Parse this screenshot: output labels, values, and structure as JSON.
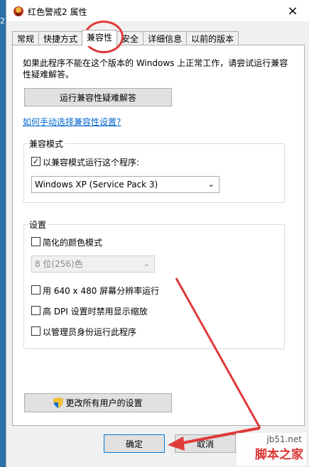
{
  "desktop": {
    "edge_number": "2"
  },
  "window": {
    "title": "红色警戒2 属性",
    "close_icon": "×"
  },
  "tabs": [
    {
      "label": "常规"
    },
    {
      "label": "快捷方式"
    },
    {
      "label": "兼容性"
    },
    {
      "label": "安全"
    },
    {
      "label": "详细信息"
    },
    {
      "label": "以前的版本"
    }
  ],
  "active_tab": "兼容性",
  "intro_text": "如果此程序不能在这个版本的 Windows 上正常工作，请尝试运行兼容性疑难解答。",
  "troubleshooter_button": "运行兼容性疑难解答",
  "manual_link": "如何手动选择兼容性设置?",
  "compat_mode": {
    "group_label": "兼容模式",
    "checkbox_label": "以兼容模式运行这个程序:",
    "checked": true,
    "selected_os": "Windows XP (Service Pack 3)"
  },
  "settings": {
    "group_label": "设置",
    "reduced_color_label": "简化的颜色模式",
    "color_select_value": "8 位(256)色",
    "res_640_label": "用 640 x 480 屏幕分辨率运行",
    "high_dpi_label": "高 DPI 设置时禁用显示缩放",
    "admin_label": "以管理员身份运行此程序"
  },
  "change_all_users_button": "更改所有用户的设置",
  "ok_button": "确定",
  "cancel_button": "取消",
  "watermark": {
    "site": "jb51.net",
    "name": "脚本之家"
  },
  "colors": {
    "annotation_red": "#e03a3a",
    "link_blue": "#0066cc"
  }
}
